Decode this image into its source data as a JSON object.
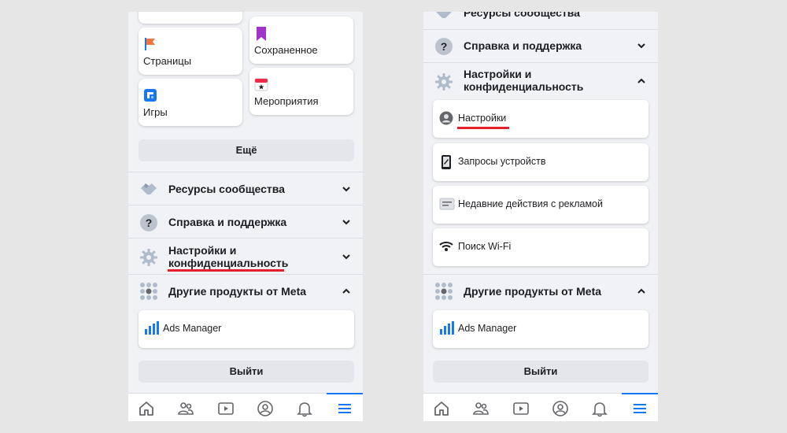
{
  "left_panel": {
    "shortcuts": [
      {
        "label": "Страницы",
        "icon": "flag-icon"
      },
      {
        "label": "Сохраненное",
        "icon": "bookmark-icon"
      },
      {
        "label": "Игры",
        "icon": "gaming-icon"
      },
      {
        "label": "Мероприятия",
        "icon": "calendar-icon"
      }
    ],
    "more_button": "Ещё",
    "sections": [
      {
        "title": "Ресурсы сообщества",
        "icon": "handshake-icon",
        "expanded": false
      },
      {
        "title": "Справка и поддержка",
        "icon": "help-icon",
        "expanded": false
      },
      {
        "title": "Настройки и конфиденциальность",
        "title_line1": "Настройки и",
        "title_line2": "конфиденциальность",
        "icon": "gear-icon",
        "expanded": false,
        "highlighted": true
      },
      {
        "title": "Другие продукты от Meta",
        "icon": "apps-grid-icon",
        "expanded": true
      }
    ],
    "meta_products": [
      {
        "label": "Ads Manager",
        "icon": "ads-manager-icon"
      }
    ],
    "logout_button": "Выйти"
  },
  "right_panel": {
    "partial_section_title": "Ресурсы сообщества",
    "sections": [
      {
        "title": "Справка и поддержка",
        "icon": "help-icon",
        "expanded": false
      },
      {
        "title": "Настройки и конфиденциальность",
        "title_line1": "Настройки и",
        "title_line2": "конфиденциальность",
        "icon": "gear-icon",
        "expanded": true
      },
      {
        "title": "Другие продукты от Meta",
        "icon": "apps-grid-icon",
        "expanded": true
      }
    ],
    "settings_items": [
      {
        "label": "Настройки",
        "icon": "profile-icon",
        "highlighted": true
      },
      {
        "label": "Запросы устройств",
        "icon": "device-icon"
      },
      {
        "label": "Недавние действия с рекламой",
        "icon": "ad-activity-icon"
      },
      {
        "label": "Поиск Wi-Fi",
        "icon": "wifi-icon"
      }
    ],
    "meta_products": [
      {
        "label": "Ads Manager",
        "icon": "ads-manager-icon"
      }
    ],
    "logout_button": "Выйти"
  },
  "tabbar": {
    "tabs": [
      {
        "name": "home-icon"
      },
      {
        "name": "friends-icon"
      },
      {
        "name": "watch-icon"
      },
      {
        "name": "profile-icon"
      },
      {
        "name": "notifications-icon"
      },
      {
        "name": "menu-icon",
        "active": true
      }
    ]
  },
  "colors": {
    "accent": "#1877f2",
    "highlight_underline": "#e41e2a",
    "background": "#f0f2f5",
    "icon_gray": "#65676b"
  }
}
